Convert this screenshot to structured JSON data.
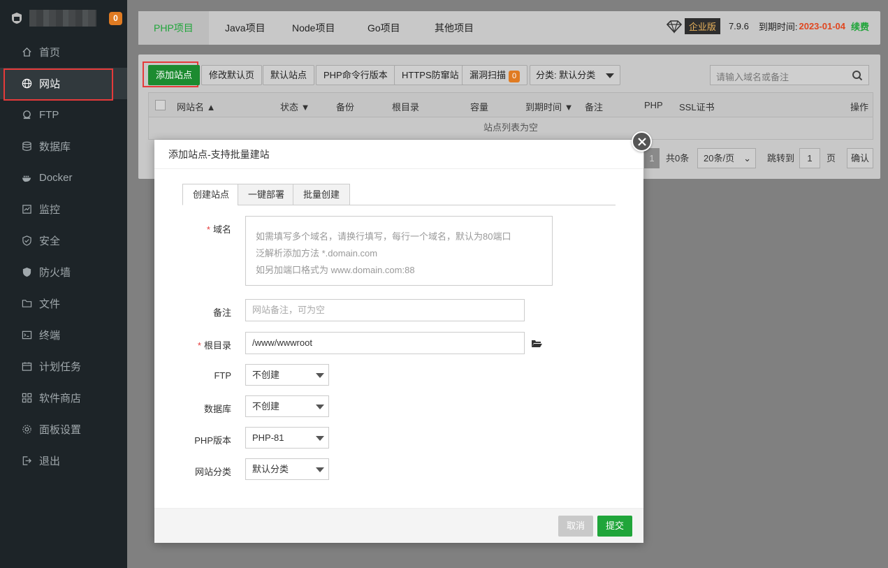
{
  "sidebar": {
    "badge": "0",
    "items": [
      {
        "label": "首页",
        "icon": "home-icon"
      },
      {
        "label": "网站",
        "icon": "globe-icon",
        "active": true
      },
      {
        "label": "FTP",
        "icon": "ftp-icon"
      },
      {
        "label": "数据库",
        "icon": "database-icon"
      },
      {
        "label": "Docker",
        "icon": "docker-icon"
      },
      {
        "label": "监控",
        "icon": "monitor-icon"
      },
      {
        "label": "安全",
        "icon": "shield-check-icon"
      },
      {
        "label": "防火墙",
        "icon": "shield-icon"
      },
      {
        "label": "文件",
        "icon": "folder-icon"
      },
      {
        "label": "终端",
        "icon": "terminal-icon"
      },
      {
        "label": "计划任务",
        "icon": "calendar-icon"
      },
      {
        "label": "软件商店",
        "icon": "grid-icon"
      },
      {
        "label": "面板设置",
        "icon": "gear-icon"
      },
      {
        "label": "退出",
        "icon": "logout-icon"
      }
    ]
  },
  "header": {
    "tabs": [
      "PHP项目",
      "Java项目",
      "Node项目",
      "Go项目",
      "其他项目"
    ],
    "edition": "企业版",
    "version": "7.9.6",
    "expire_label": "到期时间:",
    "expire_date": "2023-01-04",
    "renew": "续费"
  },
  "toolbar": {
    "add_site": "添加站点",
    "edit_default_page": "修改默认页",
    "default_site": "默认站点",
    "php_cli": "PHP命令行版本",
    "https_guard": "HTTPS防窜站",
    "vuln_scan": "漏洞扫描",
    "vuln_count": "0",
    "category": "分类: 默认分类",
    "search_placeholder": "请输入域名或备注"
  },
  "table": {
    "columns": [
      "网站名",
      "状态",
      "备份",
      "根目录",
      "容量",
      "到期时间",
      "备注",
      "PHP",
      "SSL证书",
      "操作"
    ],
    "empty": "站点列表为空"
  },
  "pager": {
    "current": "1",
    "total": "共0条",
    "per_page": "20条/页",
    "jump_label": "跳转到",
    "jump_value": "1",
    "page_unit": "页",
    "confirm": "确认"
  },
  "modal": {
    "title": "添加站点-支持批量建站",
    "tabs": [
      "创建站点",
      "一键部署",
      "批量创建"
    ],
    "domain_label": "域名",
    "domain_hint": [
      "如需填写多个域名，请换行填写，每行一个域名，默认为80端口",
      "泛解析添加方法 *.domain.com",
      "如另加端口格式为 www.domain.com:88"
    ],
    "remark_label": "备注",
    "remark_placeholder": "网站备注，可为空",
    "root_label": "根目录",
    "root_value": "/www/wwwroot",
    "ftp_label": "FTP",
    "ftp_value": "不创建",
    "db_label": "数据库",
    "db_value": "不创建",
    "php_label": "PHP版本",
    "php_value": "PHP-81",
    "cat_label": "网站分类",
    "cat_value": "默认分类",
    "cancel": "取消",
    "submit": "提交"
  }
}
